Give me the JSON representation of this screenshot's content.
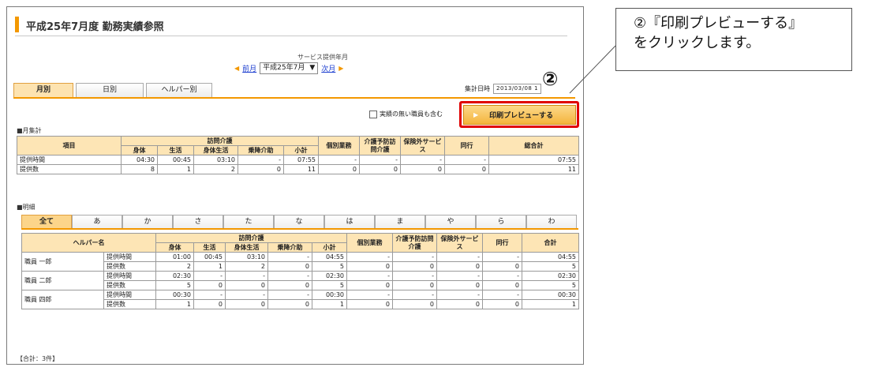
{
  "page": {
    "title": "平成25年7月度 勤務実績参照",
    "service_month_label": "サービス提供年月",
    "prev_month": "前月",
    "next_month": "次月",
    "selected_month": "平成25年7月",
    "tabs": [
      "月別",
      "日別",
      "ヘルパー別"
    ],
    "active_tab": "月別",
    "aggregate_date_label": "集計日時",
    "aggregate_date_value": "2013/03/08 1",
    "include_no_record_label": "実績の無い職員も含む",
    "print_preview_button": "印刷プレビューする"
  },
  "monthly": {
    "section_label": "■月集計",
    "header_item": "項目",
    "header_visit_care": "訪問介護",
    "sub_headers": [
      "身体",
      "生活",
      "身体生活",
      "乗降介助",
      "小計"
    ],
    "header_individual": "個別業務",
    "header_prevention": "介護予防訪問介護",
    "header_uninsured": "保険外サービス",
    "header_accompany": "同行",
    "header_total": "総合計",
    "rows": [
      {
        "label": "提供時間",
        "values": [
          "04:30",
          "00:45",
          "03:10",
          "-",
          "07:55",
          "-",
          "-",
          "-",
          "-",
          "07:55"
        ]
      },
      {
        "label": "提供数",
        "values": [
          "8",
          "1",
          "2",
          "0",
          "11",
          "0",
          "0",
          "0",
          "0",
          "11"
        ]
      }
    ]
  },
  "detail": {
    "section_label": "■明細",
    "kana_tabs": [
      "全て",
      "あ",
      "か",
      "さ",
      "た",
      "な",
      "は",
      "ま",
      "や",
      "ら",
      "わ"
    ],
    "active_kana": "全て",
    "header_helper": "ヘルパー名",
    "header_visit_care": "訪問介護",
    "sub_headers": [
      "身体",
      "生活",
      "身体生活",
      "乗降介助",
      "小計"
    ],
    "header_individual": "個別業務",
    "header_prevention": "介護予防訪問介護",
    "header_uninsured": "保険外サービス",
    "header_accompany": "同行",
    "header_total": "合計",
    "staff": [
      {
        "name": "職員 一郎",
        "rows": [
          {
            "label": "提供時間",
            "values": [
              "01:00",
              "00:45",
              "03:10",
              "-",
              "04:55",
              "-",
              "-",
              "-",
              "-",
              "04:55"
            ]
          },
          {
            "label": "提供数",
            "values": [
              "2",
              "1",
              "2",
              "0",
              "5",
              "0",
              "0",
              "0",
              "0",
              "5"
            ]
          }
        ]
      },
      {
        "name": "職員 二郎",
        "rows": [
          {
            "label": "提供時間",
            "values": [
              "02:30",
              "-",
              "-",
              "-",
              "02:30",
              "-",
              "-",
              "-",
              "-",
              "02:30"
            ]
          },
          {
            "label": "提供数",
            "values": [
              "5",
              "0",
              "0",
              "0",
              "5",
              "0",
              "0",
              "0",
              "0",
              "5"
            ]
          }
        ]
      },
      {
        "name": "職員 四郎",
        "rows": [
          {
            "label": "提供時間",
            "values": [
              "00:30",
              "-",
              "-",
              "-",
              "00:30",
              "-",
              "-",
              "-",
              "-",
              "00:30"
            ]
          },
          {
            "label": "提供数",
            "values": [
              "1",
              "0",
              "0",
              "0",
              "1",
              "0",
              "0",
              "0",
              "0",
              "1"
            ]
          }
        ]
      }
    ],
    "total_label": "【合計：3件】"
  },
  "annotation": {
    "callout_line1": "②『印刷プレビューする』",
    "callout_line2": "をクリックします。",
    "marker": "②",
    "highlight_color": "#e00000"
  },
  "colors": {
    "accent": "#f39800",
    "header_bg": "#fde5b5",
    "link": "#1a3ccf"
  }
}
